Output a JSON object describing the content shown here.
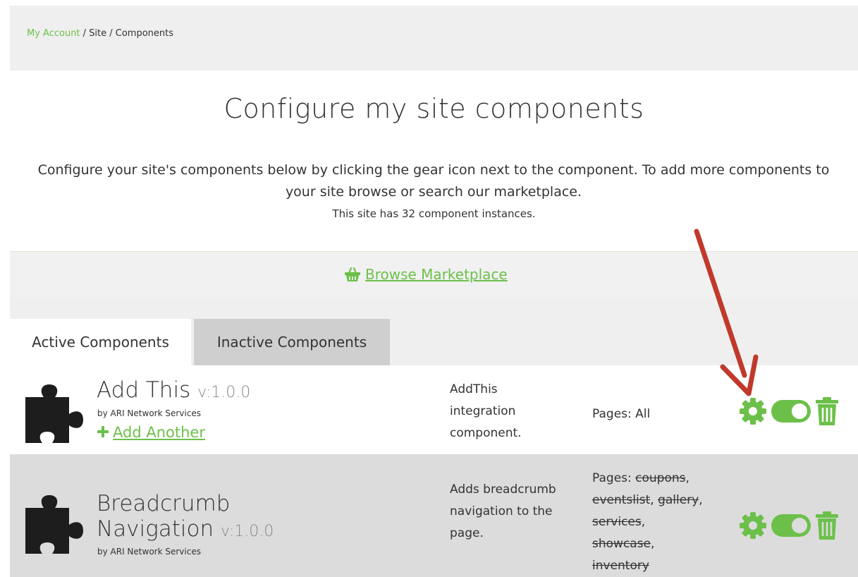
{
  "breadcrumb": {
    "link": "My Account",
    "rest": " / Site / Components"
  },
  "page": {
    "title": "Configure my site components",
    "description": "Configure your site's components below by clicking the gear icon next to the component. To add more components to your site browse or search our marketplace.",
    "instance_count": "This site has 32 component instances."
  },
  "marketplace": {
    "label": "Browse Marketplace",
    "icon": "basket-icon"
  },
  "tabs": [
    {
      "label": "Active Components",
      "active": true
    },
    {
      "label": "Inactive Components",
      "active": false
    }
  ],
  "components": [
    {
      "name": "Add This",
      "version": "v:1.0.0",
      "by": "by ARI Network Services",
      "add_another": "Add Another",
      "description": "AddThis integration component.",
      "pages_label": "Pages: All"
    },
    {
      "name_line1": "Breadcrumb",
      "name_line2": "Navigation",
      "version": "v:1.0.0",
      "by": "by ARI Network Services",
      "description": "Adds breadcrumb navigation to the page.",
      "pages_prefix": "Pages:",
      "pages": [
        "coupons",
        "eventslist",
        "gallery",
        "services",
        "showcase",
        "inventory"
      ]
    }
  ],
  "colors": {
    "accent": "#6cc04a",
    "annotation_arrow": "#c0392b"
  }
}
